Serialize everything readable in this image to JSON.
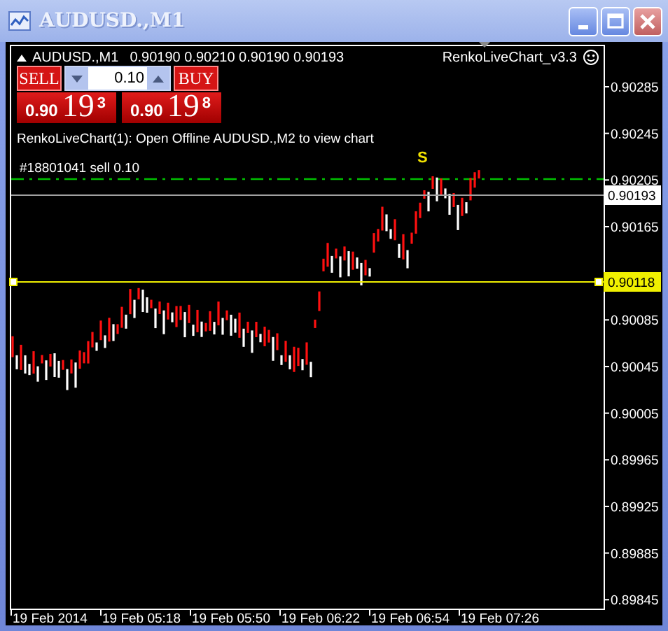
{
  "window": {
    "title": "AUDUSD.,M1"
  },
  "chart_header": {
    "symbol": "AUDUSD.,M1",
    "ohlc": [
      "0.90190",
      "0.90210",
      "0.90190",
      "0.90193"
    ],
    "indicator": "RenkoLiveChart_v3.3"
  },
  "trade_panel": {
    "sell_label": "SELL",
    "buy_label": "BUY",
    "lot": "0.10",
    "sell_price": {
      "base": "0.90",
      "big": "19",
      "small": "3"
    },
    "buy_price": {
      "base": "0.90",
      "big": "19",
      "small": "8"
    }
  },
  "message": "RenkoLiveChart(1): Open Offline AUDUSD.,M2 to view chart",
  "order_label": "#18801041 sell 0.10",
  "signal": "S",
  "price_axis": [
    "0.90285",
    "0.90245",
    "0.90205",
    "0.90165",
    "0.90085",
    "0.90045",
    "0.90005",
    "0.89965",
    "0.89925",
    "0.89885",
    "0.89845"
  ],
  "price_markers": [
    {
      "kind": "bid",
      "value": "0.90193"
    },
    {
      "kind": "level",
      "value": "0.90118"
    }
  ],
  "time_axis": [
    "19 Feb 2014",
    "19 Feb 05:18",
    "19 Feb 05:50",
    "19 Feb 06:22",
    "19 Feb 06:54",
    "19 Feb 07:26"
  ]
}
